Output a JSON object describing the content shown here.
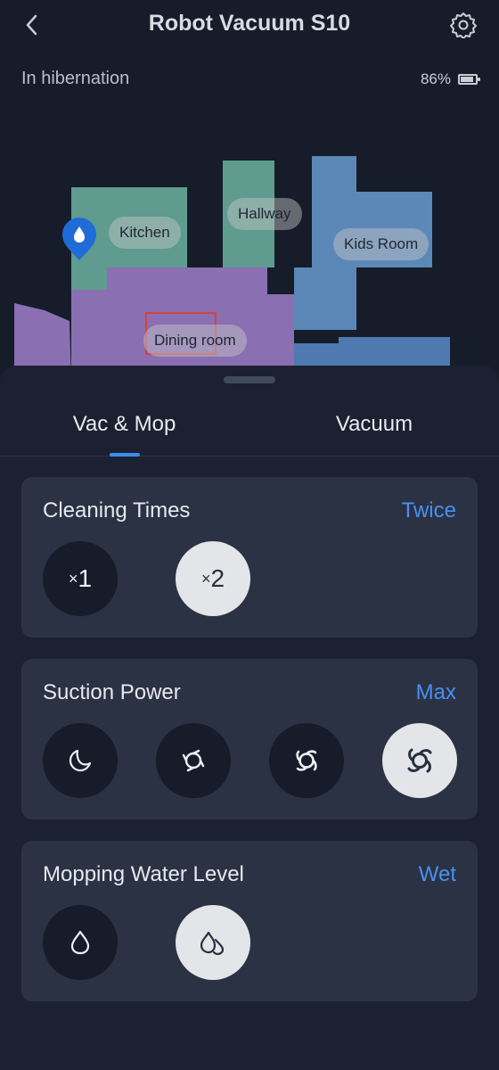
{
  "header": {
    "title": "Robot Vacuum S10",
    "back_icon": "chevron-left-icon",
    "settings_icon": "gear-icon"
  },
  "status": {
    "state": "In hibernation",
    "battery": "86%",
    "battery_level": 0.86
  },
  "map": {
    "rooms": [
      {
        "name": "Kitchen",
        "color": "#5f9b8f"
      },
      {
        "name": "Hallway",
        "color": "#5f9b8f"
      },
      {
        "name": "Kids Room",
        "color": "#5b88b6"
      },
      {
        "name": "Dining room",
        "color": "#8a6fb2"
      }
    ],
    "pin_icon": "water-drop-pin-icon"
  },
  "tabs": [
    {
      "label": "Vac & Mop",
      "active": true
    },
    {
      "label": "Vacuum",
      "active": false
    }
  ],
  "cards": {
    "cleaning_times": {
      "title": "Cleaning Times",
      "value": "Twice",
      "options": [
        {
          "mult": "×",
          "num": "1",
          "selected": false
        },
        {
          "mult": "×",
          "num": "2",
          "selected": true
        }
      ]
    },
    "suction": {
      "title": "Suction Power",
      "value": "Max",
      "options": [
        {
          "icon": "moon-icon",
          "selected": false
        },
        {
          "icon": "fan-low-icon",
          "selected": false
        },
        {
          "icon": "fan-medium-icon",
          "selected": false
        },
        {
          "icon": "fan-max-icon",
          "selected": true
        }
      ]
    },
    "water": {
      "title": "Mopping Water Level",
      "value": "Wet",
      "options": [
        {
          "icon": "drop-icon",
          "selected": false
        },
        {
          "icon": "double-drop-icon",
          "selected": true
        }
      ]
    }
  },
  "colors": {
    "accent": "#4a90f0",
    "card_bg": "#2a3244",
    "selected_bg": "#e4e5e8"
  }
}
